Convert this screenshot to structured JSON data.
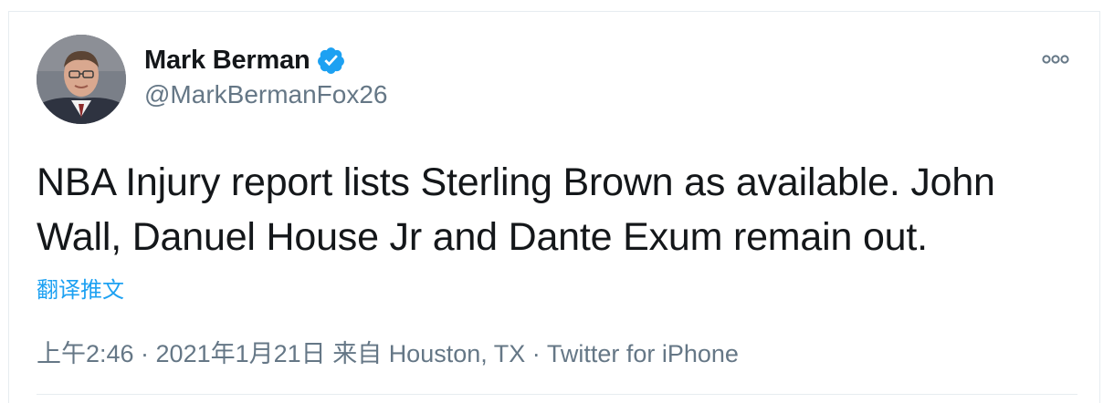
{
  "tweet": {
    "author_name": "Mark Berman",
    "author_handle": "@MarkBermanFox26",
    "verified": true,
    "text": "NBA Injury report lists Sterling Brown as available. John Wall, Danuel House Jr and Dante Exum remain out.",
    "translate_label": "翻译推文",
    "timestamp": "上午2:46 · 2021年1月21日",
    "location": "来自 Houston, TX",
    "separator": "·",
    "source": "Twitter for iPhone"
  },
  "icons": {
    "verified": "verified-badge-icon",
    "more": "more-options-icon"
  },
  "colors": {
    "text": "#14171a",
    "secondary": "#657786",
    "link": "#1da1f2",
    "verified": "#1da1f2",
    "border": "#e6ecf0"
  }
}
